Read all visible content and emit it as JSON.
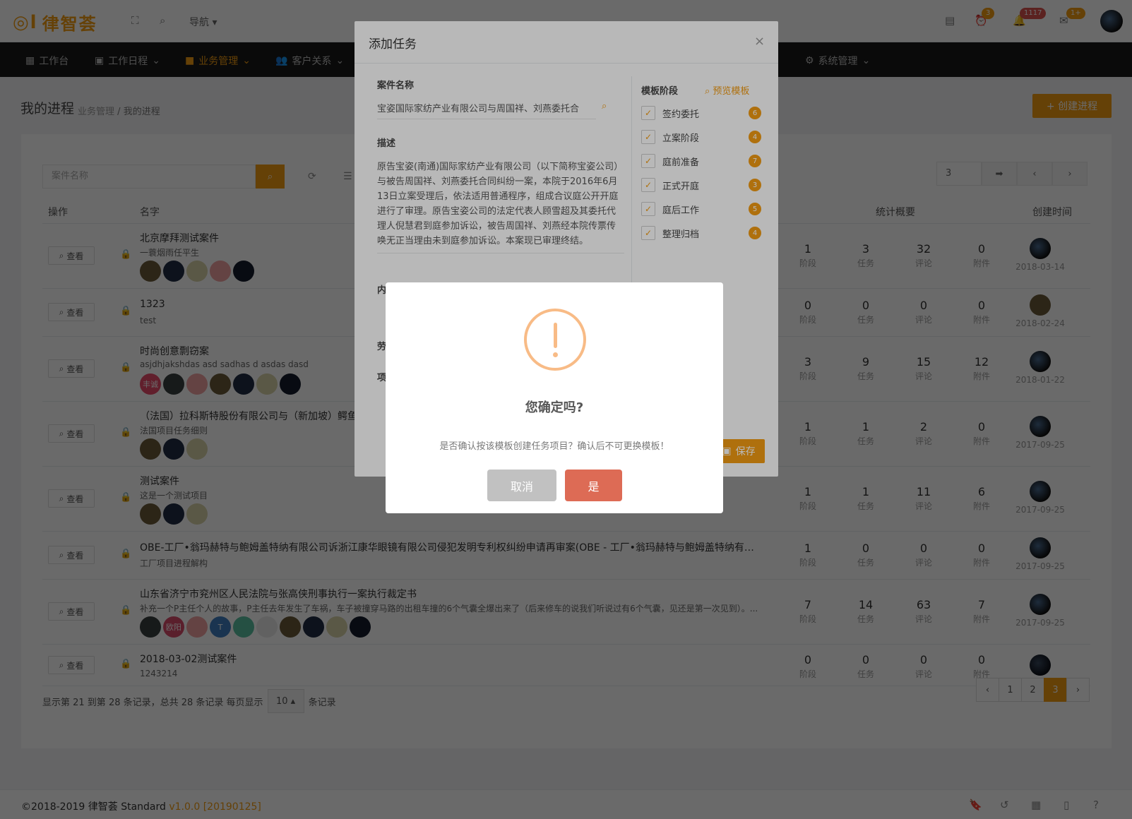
{
  "topbar": {
    "logo_text": "律智荟",
    "nav_label": "导航",
    "badges": {
      "alarm": "3",
      "bell": "1117",
      "mail": "1+"
    }
  },
  "navbar": {
    "items": [
      {
        "label": "工作台",
        "icon": "dashboard-icon"
      },
      {
        "label": "工作日程",
        "icon": "calendar-icon"
      },
      {
        "label": "业务管理",
        "icon": "briefcase-icon",
        "active": true
      },
      {
        "label": "客户关系",
        "icon": "users-icon"
      },
      {
        "label": "系统管理",
        "icon": "gear-icon"
      }
    ]
  },
  "page": {
    "title": "我的进程",
    "breadcrumb_parent": "业务管理",
    "breadcrumb_sep": "/",
    "breadcrumb_current": "我的进程",
    "create_label": "+ 创建进程"
  },
  "toolbar": {
    "search_placeholder": "案件名称",
    "page_jump_value": "3"
  },
  "table": {
    "headers": {
      "action": "操作",
      "name": "名字",
      "stats": "统计概要",
      "created": "创建时间"
    },
    "view_label": "查看",
    "stat_labels": [
      "阶段",
      "任务",
      "评论",
      "附件"
    ],
    "rows": [
      {
        "name": "北京摩拜测试案件",
        "desc": "一蓑烟雨任平生",
        "stats": [
          "1",
          "3",
          "32",
          "0"
        ],
        "date": "2018-03-14"
      },
      {
        "name": "1323",
        "desc": "test",
        "stats": [
          "0",
          "0",
          "0",
          "0"
        ],
        "date": "2018-02-24"
      },
      {
        "name": "时尚创意剽窃案",
        "desc": "asjdhjakshdas asd sadhas d asdas dasd",
        "stats": [
          "3",
          "9",
          "15",
          "12"
        ],
        "date": "2018-01-22"
      },
      {
        "name": "（法国）拉科斯特股份有限公司与（新加坡）鳄鱼",
        "desc": "法国项目任务细则",
        "stats": [
          "1",
          "1",
          "2",
          "0"
        ],
        "date": "2017-09-25"
      },
      {
        "name": "测试案件",
        "desc": "这是一个测试项目",
        "stats": [
          "1",
          "1",
          "11",
          "6"
        ],
        "date": "2017-09-25"
      },
      {
        "name": "OBE-工厂•翁玛赫特与鲍姆盖特纳有限公司诉浙江康华眼镜有限公司侵犯发明专利权纠纷申请再审案(OBE - 工厂•翁玛赫特与鲍姆盖特纳有限...",
        "desc": "工厂项目进程解构",
        "stats": [
          "1",
          "0",
          "0",
          "0"
        ],
        "date": "2017-09-25"
      },
      {
        "name": "山东省济宁市兖州区人民法院与张高侠刑事执行一案执行裁定书",
        "desc": "补充一个P主任个人的故事，P主任去年发生了车祸，车子被撞穿马路的出租车撞的6个气囊全爆出来了（后来修车的说我们听说过有6个气囊，见还是第一次见到）。...",
        "stats": [
          "7",
          "14",
          "63",
          "7"
        ],
        "date": "2017-09-25"
      },
      {
        "name": "2018-03-02测试案件",
        "desc": "1243214",
        "stats": [
          "0",
          "0",
          "0",
          "0"
        ],
        "date": ""
      }
    ],
    "member_text": {
      "feng": "丰诚",
      "ouyang": "欧阳",
      "t": "T"
    }
  },
  "pagination": {
    "info_prefix": "显示第 21 到第 28 条记录，总共 28 条记录 每页显示",
    "page_size": "10",
    "info_suffix": "条记录",
    "pages": [
      "‹",
      "1",
      "2",
      "3",
      "›"
    ],
    "current": "3"
  },
  "footer": {
    "copyright": "©2018-2019 律智荟  Standard",
    "version": "v1.0.0 [20190125]"
  },
  "modal": {
    "title": "添加任务",
    "case_label": "案件名称",
    "case_value": "宝姿国际家纺产业有限公司与周国祥、刘燕委托合",
    "desc_label": "描述",
    "desc_text": "原告宝姿(南通)国际家纺产业有限公司（以下简称宝姿公司）与被告周国祥、刘燕委托合同纠纷一案，本院于2016年6月13日立案受理后，依法适用普通程序，组成合议庭公开开庭进行了审理。原告宝姿公司的法定代表人顾雪超及其委托代理人倪慧君到庭参加诉讼，被告周国祥、刘燕经本院传票传唤无正当理由未到庭参加诉讼。本案现已审理终结。",
    "partial_labels": [
      "内",
      "劳",
      "项"
    ],
    "template_label": "模板阶段",
    "preview_label": "预览模板",
    "stages": [
      {
        "label": "签约委托",
        "count": "6"
      },
      {
        "label": "立案阶段",
        "count": "4"
      },
      {
        "label": "庭前准备",
        "count": "7"
      },
      {
        "label": "正式开庭",
        "count": "3"
      },
      {
        "label": "庭后工作",
        "count": "5"
      },
      {
        "label": "整理归档",
        "count": "4"
      }
    ],
    "save_label": "保存"
  },
  "alert": {
    "title": "您确定吗?",
    "text": "是否确认按该模板创建任务项目？确认后不可更换模板！",
    "cancel_label": "取消",
    "confirm_label": "是"
  },
  "colors": {
    "accent": "#f39c12",
    "danger": "#dd6b55",
    "warning_icon": "#f8bb86"
  }
}
